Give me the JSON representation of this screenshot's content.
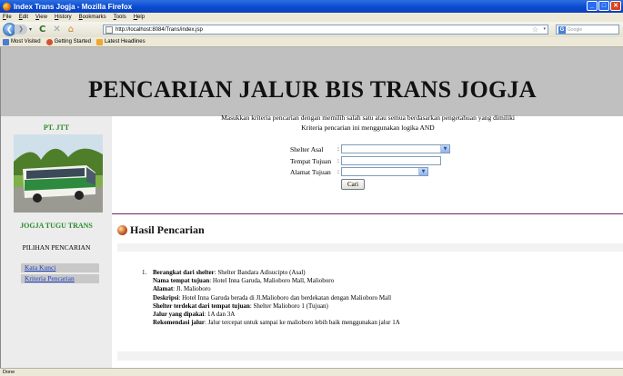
{
  "window": {
    "title": "Index Trans Jogja - Mozilla Firefox"
  },
  "menu": [
    "File",
    "Edit",
    "View",
    "History",
    "Bookmarks",
    "Tools",
    "Help"
  ],
  "nav": {
    "url": "http://localhost:8084/Trans/index.jsp",
    "search_placeholder": "Google"
  },
  "bookmarks": [
    "Most Visited",
    "Getting Started",
    "Latest Headlines"
  ],
  "page": {
    "title": "PENCARIAN JALUR BIS TRANS JOGJA",
    "sidebar": {
      "company": "PT. JTT",
      "bus_caption": "JOGJA TUGU TRANS",
      "pilihan": "PILIHAN PENCARIAN",
      "links": [
        "Kata Kunci",
        "Kriteria Pencarian"
      ]
    },
    "instructions": [
      "Masukkan kriteria pencarian dengan memilih salah satu atau semua berdasarkan pengetahuan yang dimiliki",
      "Kriteria pencarian ini menggunakan logika AND"
    ],
    "form": {
      "shelter_asal": "Shelter Asal",
      "tempat_tujuan": "Tempat Tujuan",
      "alamat_tujuan": "Alamat Tujuan",
      "colon": ":",
      "cari": "Cari"
    },
    "hasil_title": "Hasil Pencarian",
    "result": {
      "number": "1.",
      "fields": [
        {
          "label": "Berangkat dari shelter",
          "value": ": Shelter Bandara Adisucipto (Asal)"
        },
        {
          "label": "Nama tempat tujuan",
          "value": ": Hotel Inna Garuda, Malioboro Mall, Malioboro"
        },
        {
          "label": "Alamat",
          "value": ": Jl. Malioboro"
        },
        {
          "label": "Deskripsi",
          "value": ": Hotel Inna Garuda berada di Jl.Malioboro dan berdekatan dengan Malioboro Mall"
        },
        {
          "label": "Shelter terdekat dari tempat tujuan",
          "value": ": Shelter Malioboro 1 (Tujuan)"
        },
        {
          "label": "Jalur yang dipakai",
          "value": ": 1A dan 3A"
        },
        {
          "label": "Rekomendasi jalur",
          "value": ": Jalur tercepat untuk sampai ke malioboro lebih baik menggunakan jalur 1A"
        }
      ]
    }
  },
  "status": "Done"
}
